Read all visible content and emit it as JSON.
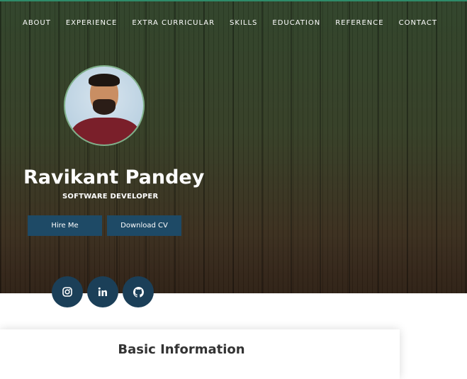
{
  "nav": {
    "items": [
      {
        "label": "ABOUT"
      },
      {
        "label": "EXPERIENCE"
      },
      {
        "label": "EXTRA CURRICULAR"
      },
      {
        "label": "SKILLS"
      },
      {
        "label": "EDUCATION"
      },
      {
        "label": "REFERENCE"
      },
      {
        "label": "CONTACT"
      }
    ]
  },
  "profile": {
    "name": "Ravikant Pandey",
    "role": "SOFTWARE DEVELOPER"
  },
  "buttons": {
    "hire_label": "Hire Me",
    "cv_label": "Download CV"
  },
  "social": {
    "icons": [
      "instagram-icon",
      "linkedin-icon",
      "github-icon"
    ]
  },
  "section": {
    "title": "Basic Information"
  },
  "colors": {
    "accent": "#1e4a66",
    "social_bg": "#1b3f58"
  }
}
